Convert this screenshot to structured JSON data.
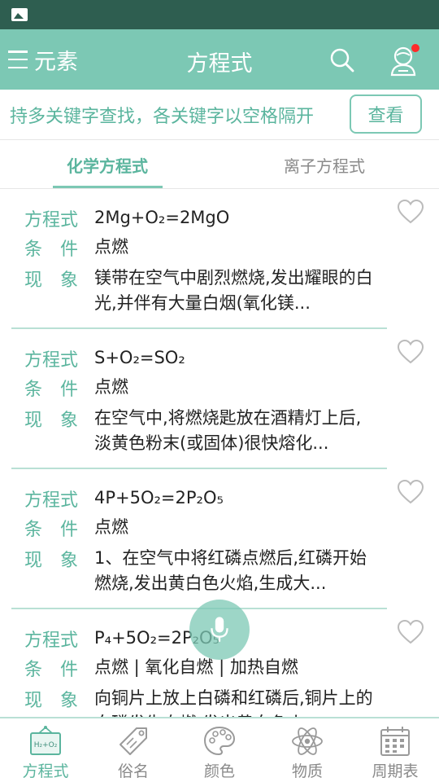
{
  "appbar": {
    "menu_label": "元素",
    "title": "方程式",
    "accent_color": "#7cc8b4",
    "notification_dot_color": "#ff2a2a"
  },
  "search": {
    "hint": "持多关键字查找，各关键字以空格隔开",
    "button_label": "查看"
  },
  "tabs": [
    {
      "label": "化学方程式",
      "active": true
    },
    {
      "label": "离子方程式",
      "active": false
    }
  ],
  "field_labels": {
    "equation": "方程式",
    "condition": "条　件",
    "phenomenon": "现　象"
  },
  "equations": [
    {
      "equation": "2Mg+O₂=2MgO",
      "condition": "点燃",
      "phenomenon": "镁带在空气中剧烈燃烧,发出耀眼的白光,并伴有大量白烟(氧化镁..."
    },
    {
      "equation": "S+O₂=SO₂",
      "condition": "点燃",
      "phenomenon": "在空气中,将燃烧匙放在酒精灯上后,淡黄色粉末(或固体)很快熔化..."
    },
    {
      "equation": "4P+5O₂=2P₂O₅",
      "condition": "点燃",
      "phenomenon": "1、在空气中将红磷点燃后,红磷开始燃烧,发出黄白色火焰,生成大..."
    },
    {
      "equation": "P₄+5O₂=2P₂O₅",
      "condition": "点燃 | 氧化自燃 | 加热自燃",
      "phenomenon": "向铜片上放上白磷和红磷后,铜片上的白磷发生自燃,发出黄白色火..."
    }
  ],
  "bottom_nav": [
    {
      "label": "方程式",
      "icon": "equation-board-icon",
      "icon_text": "H₂+O₂",
      "active": true
    },
    {
      "label": "俗名",
      "icon": "tag-icon",
      "active": false
    },
    {
      "label": "颜色",
      "icon": "palette-icon",
      "active": false
    },
    {
      "label": "物质",
      "icon": "atom-icon",
      "active": false
    },
    {
      "label": "周期表",
      "icon": "calendar-table-icon",
      "active": false
    }
  ]
}
